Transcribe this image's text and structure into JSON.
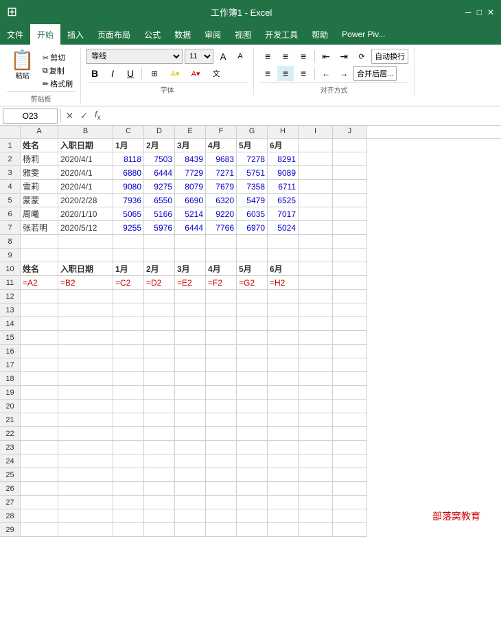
{
  "title": "工作簿1 - Excel",
  "menu": {
    "items": [
      "文件",
      "开始",
      "插入",
      "页面布局",
      "公式",
      "数据",
      "审阅",
      "视图",
      "开发工具",
      "帮助",
      "Power Piv..."
    ],
    "active": "开始"
  },
  "ribbon": {
    "clipboard": {
      "label": "剪贴板",
      "paste": "粘贴",
      "cut": "✂ 剪切",
      "copy": "复制",
      "format": "✏ 格式刷"
    },
    "font": {
      "label": "字体",
      "name": "等线",
      "size": "11",
      "bold": "B",
      "italic": "I",
      "underline": "U"
    },
    "alignment": {
      "label": "对齐方式",
      "wrap": "自动换行",
      "merge": "合并后居..."
    }
  },
  "formulaBar": {
    "cellName": "O23",
    "formula": ""
  },
  "columns": [
    "A",
    "B",
    "C",
    "D",
    "E",
    "F",
    "G",
    "H",
    "I",
    "J"
  ],
  "columnHeaders": [
    "姓名",
    "入职日期",
    "1月",
    "2月",
    "3月",
    "4月",
    "5月",
    "6月"
  ],
  "rows": [
    {
      "id": 1,
      "cells": [
        "姓名",
        "入职日期",
        "1月",
        "2月",
        "3月",
        "4月",
        "5月",
        "6月",
        "",
        ""
      ]
    },
    {
      "id": 2,
      "cells": [
        "杨莉",
        "2020/4/1",
        "8118",
        "7503",
        "8439",
        "9683",
        "7278",
        "8291",
        "",
        ""
      ]
    },
    {
      "id": 3,
      "cells": [
        "雅雯",
        "2020/4/1",
        "6880",
        "6444",
        "7729",
        "7271",
        "5751",
        "9089",
        "",
        ""
      ]
    },
    {
      "id": 4,
      "cells": [
        "雪莉",
        "2020/4/1",
        "9080",
        "9275",
        "8079",
        "7679",
        "7358",
        "6711",
        "",
        ""
      ]
    },
    {
      "id": 5,
      "cells": [
        "蒙蒙",
        "2020/2/28",
        "7936",
        "6550",
        "6690",
        "6320",
        "5479",
        "6525",
        "",
        ""
      ]
    },
    {
      "id": 6,
      "cells": [
        "周曦",
        "2020/1/10",
        "5065",
        "5166",
        "5214",
        "9220",
        "6035",
        "7017",
        "",
        ""
      ]
    },
    {
      "id": 7,
      "cells": [
        "张若明",
        "2020/5/12",
        "9255",
        "5976",
        "6444",
        "7766",
        "6970",
        "5024",
        "",
        ""
      ]
    },
    {
      "id": 8,
      "cells": [
        "",
        "",
        "",
        "",
        "",
        "",
        "",
        "",
        "",
        ""
      ]
    },
    {
      "id": 9,
      "cells": [
        "",
        "",
        "",
        "",
        "",
        "",
        "",
        "",
        "",
        ""
      ]
    },
    {
      "id": 10,
      "cells": [
        "姓名",
        "入职日期",
        "1月",
        "2月",
        "3月",
        "4月",
        "5月",
        "6月",
        "",
        ""
      ]
    },
    {
      "id": 11,
      "cells": [
        "=A2",
        "=B2",
        "=C2",
        "=D2",
        "=E2",
        "=F2",
        "=G2",
        "=H2",
        "",
        ""
      ]
    },
    {
      "id": 12,
      "cells": [
        "",
        "",
        "",
        "",
        "",
        "",
        "",
        "",
        "",
        ""
      ]
    },
    {
      "id": 13,
      "cells": [
        "",
        "",
        "",
        "",
        "",
        "",
        "",
        "",
        "",
        ""
      ]
    },
    {
      "id": 14,
      "cells": [
        "",
        "",
        "",
        "",
        "",
        "",
        "",
        "",
        "",
        ""
      ]
    },
    {
      "id": 15,
      "cells": [
        "",
        "",
        "",
        "",
        "",
        "",
        "",
        "",
        "",
        ""
      ]
    },
    {
      "id": 16,
      "cells": [
        "",
        "",
        "",
        "",
        "",
        "",
        "",
        "",
        "",
        ""
      ]
    },
    {
      "id": 17,
      "cells": [
        "",
        "",
        "",
        "",
        "",
        "",
        "",
        "",
        "",
        ""
      ]
    },
    {
      "id": 18,
      "cells": [
        "",
        "",
        "",
        "",
        "",
        "",
        "",
        "",
        "",
        ""
      ]
    },
    {
      "id": 19,
      "cells": [
        "",
        "",
        "",
        "",
        "",
        "",
        "",
        "",
        "",
        ""
      ]
    },
    {
      "id": 20,
      "cells": [
        "",
        "",
        "",
        "",
        "",
        "",
        "",
        "",
        "",
        ""
      ]
    },
    {
      "id": 21,
      "cells": [
        "",
        "",
        "",
        "",
        "",
        "",
        "",
        "",
        "",
        ""
      ]
    },
    {
      "id": 22,
      "cells": [
        "",
        "",
        "",
        "",
        "",
        "",
        "",
        "",
        "",
        ""
      ]
    },
    {
      "id": 23,
      "cells": [
        "",
        "",
        "",
        "",
        "",
        "",
        "",
        "",
        "",
        ""
      ]
    },
    {
      "id": 24,
      "cells": [
        "",
        "",
        "",
        "",
        "",
        "",
        "",
        "",
        "",
        ""
      ]
    },
    {
      "id": 25,
      "cells": [
        "",
        "",
        "",
        "",
        "",
        "",
        "",
        "",
        "",
        ""
      ]
    },
    {
      "id": 26,
      "cells": [
        "",
        "",
        "",
        "",
        "",
        "",
        "",
        "",
        "",
        ""
      ]
    },
    {
      "id": 27,
      "cells": [
        "",
        "",
        "",
        "",
        "",
        "",
        "",
        "",
        "",
        ""
      ]
    },
    {
      "id": 28,
      "cells": [
        "",
        "",
        "",
        "",
        "",
        "",
        "",
        "",
        "",
        ""
      ]
    },
    {
      "id": 29,
      "cells": [
        "",
        "",
        "",
        "",
        "",
        "",
        "",
        "",
        "",
        ""
      ]
    }
  ],
  "watermark": "部落窝教育",
  "colors": {
    "excel_green": "#217346",
    "header_bg": "#f0f0f0",
    "blue_text": "#0000cc",
    "red_text": "#cc0000",
    "cell_border": "#d0d0d0"
  }
}
